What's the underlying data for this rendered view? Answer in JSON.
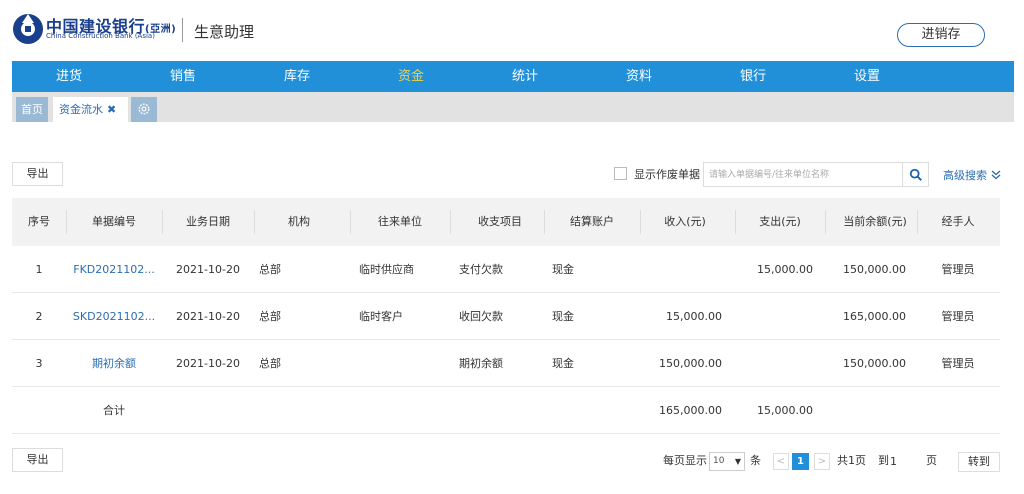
{
  "header": {
    "brand_cn": "中国建设银行",
    "brand_cn_sub": "(亞洲)",
    "brand_en": "China Construction Bank (Asia)",
    "app_name": "生意助理",
    "jxc_button": "进销存"
  },
  "nav": {
    "items": [
      {
        "label": "进货",
        "active": false
      },
      {
        "label": "销售",
        "active": false
      },
      {
        "label": "库存",
        "active": false
      },
      {
        "label": "资金",
        "active": true
      },
      {
        "label": "统计",
        "active": false
      },
      {
        "label": "资料",
        "active": false
      },
      {
        "label": "银行",
        "active": false
      },
      {
        "label": "设置",
        "active": false
      }
    ]
  },
  "tabs": {
    "home": "首页",
    "cash_flow": "资金流水",
    "close_glyph": "✖"
  },
  "toolbar": {
    "export_label": "导出",
    "void_checkbox_label": "显示作废单据",
    "void_checked": false,
    "search_placeholder": "请输入单据编号/往来单位名称",
    "advanced_search": "高级搜索"
  },
  "table": {
    "columns": [
      "序号",
      "单据编号",
      "业务日期",
      "机构",
      "往来单位",
      "收支项目",
      "结算账户",
      "收入(元)",
      "支出(元)",
      "当前余额(元)",
      "经手人"
    ],
    "rows": [
      {
        "seq": "1",
        "no": "FKD2021102...",
        "date": "2021-10-20",
        "org": "总部",
        "party": "临时供应商",
        "item": "支付欠款",
        "account": "现金",
        "income": "",
        "expense": "15,000.00",
        "balance": "150,000.00",
        "operator": "管理员"
      },
      {
        "seq": "2",
        "no": "SKD2021102...",
        "date": "2021-10-20",
        "org": "总部",
        "party": "临时客户",
        "item": "收回欠款",
        "account": "现金",
        "income": "15,000.00",
        "expense": "",
        "balance": "165,000.00",
        "operator": "管理员"
      },
      {
        "seq": "3",
        "no": "期初余额",
        "date": "2021-10-20",
        "org": "总部",
        "party": "",
        "item": "期初余额",
        "account": "现金",
        "income": "150,000.00",
        "expense": "",
        "balance": "150,000.00",
        "operator": "管理员"
      }
    ],
    "total": {
      "label": "合计",
      "income": "165,000.00",
      "expense": "15,000.00"
    }
  },
  "pagination": {
    "per_page_label": "每页显示",
    "per_page_value": "10",
    "unit": "条",
    "prev": "<",
    "current_page": "1",
    "next": ">",
    "total_pages_label": "共1页",
    "goto_label": "到",
    "goto_value": "1",
    "page_unit": "页",
    "go_button": "转到"
  },
  "colors": {
    "nav_bg": "#2290d8",
    "nav_active": "#f3d34a",
    "link": "#2a6db5",
    "brand": "#1a3f8c"
  }
}
